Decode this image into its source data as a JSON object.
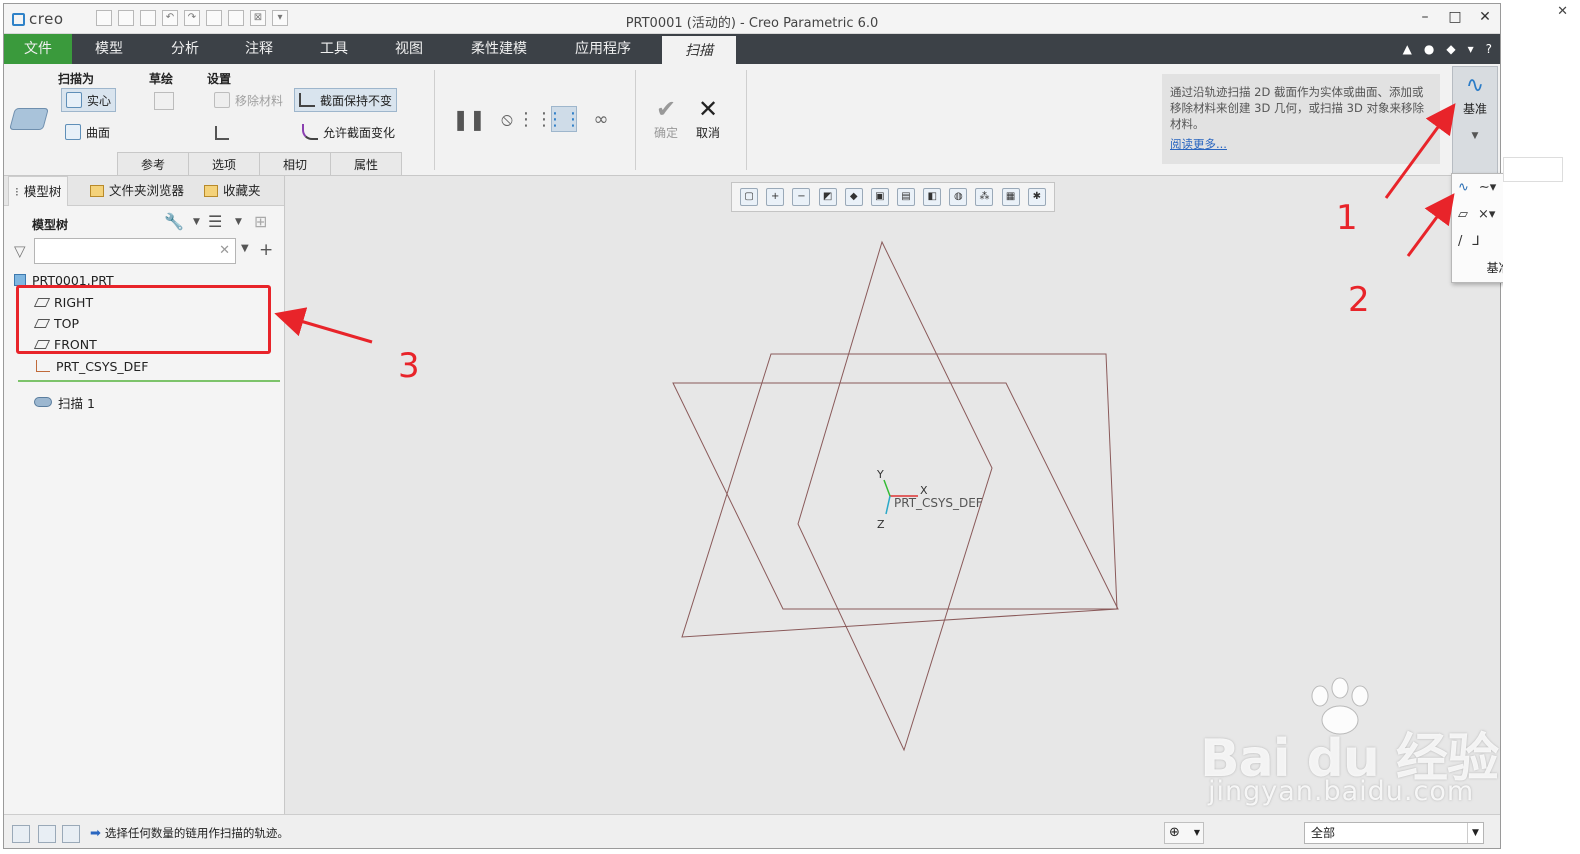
{
  "titlebar": {
    "logo": "creo",
    "title": "PRT0001 (活动的) - Creo Parametric 6.0",
    "controls": [
      "–",
      "□",
      "✕"
    ]
  },
  "menu": {
    "tabs": [
      "文件",
      "模型",
      "分析",
      "注释",
      "工具",
      "视图",
      "柔性建模",
      "应用程序",
      "扫描"
    ],
    "active": "扫描",
    "right_icons": [
      "▲",
      "●",
      "◆",
      "▾",
      "?"
    ]
  },
  "ribbon": {
    "sweep_as": {
      "label": "扫描为",
      "solid": "实心",
      "surface": "曲面"
    },
    "sketch": {
      "label": "草绘"
    },
    "settings": {
      "label": "设置",
      "remove_material": "移除材料",
      "constant_section": "截面保持不变",
      "variable_section": "允许截面变化"
    },
    "group_tabs": [
      "参考",
      "选项",
      "相切",
      "属性"
    ],
    "ok": "确定",
    "cancel": "取消",
    "description": "通过沿轨迹扫描 2D 截面作为实体或曲面、添加或移除材料来创建 3D 几何，或扫描 3D 对象来移除材料。",
    "read_more": "阅读更多...",
    "datum_label": "基准"
  },
  "left_panel": {
    "tabs": [
      "模型树",
      "文件夹浏览器",
      "收藏夹"
    ],
    "tree_title": "模型树",
    "tree": {
      "root": "PRT0001.PRT",
      "planes": [
        "RIGHT",
        "TOP",
        "FRONT"
      ],
      "csys": "PRT_CSYS_DEF",
      "feature": "扫描 1"
    }
  },
  "viewport": {
    "csys_label": "PRT_CSYS_DEF",
    "axis_x": "X",
    "axis_y": "Y",
    "axis_z": "Z"
  },
  "datum_flyout": {
    "label": "基准"
  },
  "status": {
    "message": "选择任何数量的链用作扫描的轨迹。",
    "filter": "全部"
  },
  "annotations": {
    "numbers": [
      "1",
      "2",
      "3"
    ],
    "color": "#e8242a"
  },
  "watermark": {
    "brand": "Bai du 经验",
    "url": "jingyan.baidu.com"
  },
  "colors": {
    "file_tab": "#3a9a3c",
    "menubar": "#3c4147",
    "plane_lines": "#8a5a5a"
  }
}
